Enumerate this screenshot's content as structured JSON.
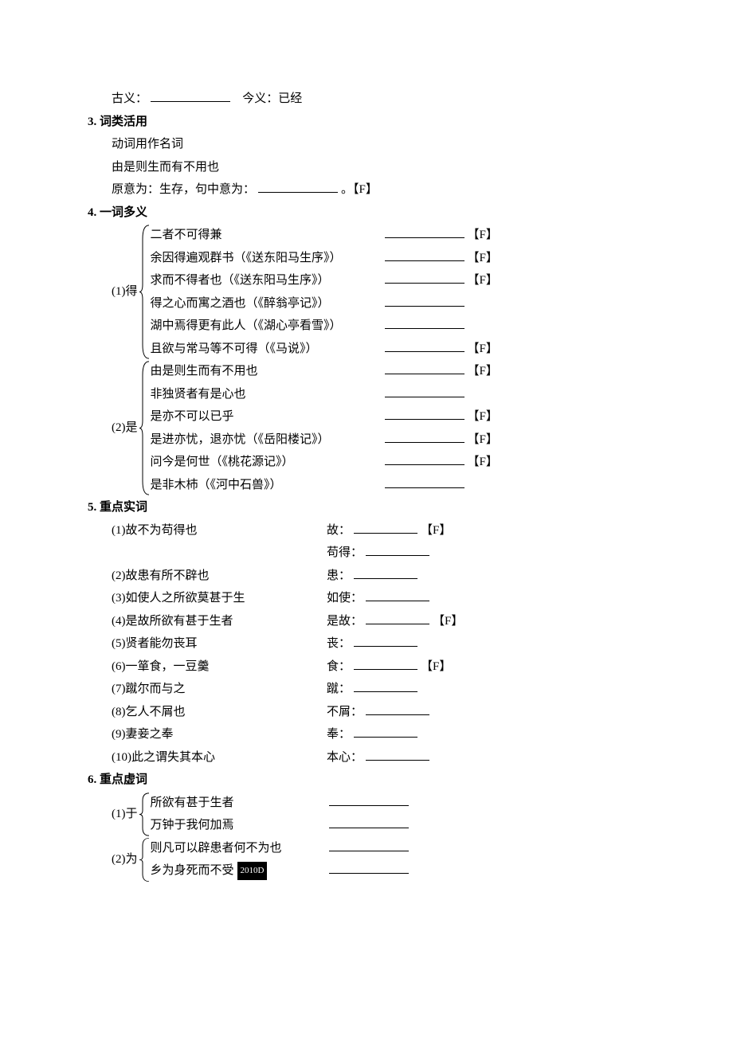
{
  "line_guyi": {
    "prefix": "古义：",
    "today_label": "今义：",
    "today_value": "已经"
  },
  "s3": {
    "heading": "3. 词类活用",
    "l1": "动词用作名词",
    "l2": "由是则生而有不用也",
    "l3a": "原意为：生存，句中意为：",
    "l3b": "。【F】"
  },
  "s4": {
    "heading": "4. 一词多义",
    "g1": {
      "label": "(1)得",
      "items": [
        {
          "text": "二者不可得兼",
          "tag": "【F】"
        },
        {
          "text": "余因得遍观群书（《送东阳马生序》）",
          "tag": "【F】"
        },
        {
          "text": "求而不得者也（《送东阳马生序》）",
          "tag": "【F】"
        },
        {
          "text": "得之心而寓之酒也（《醉翁亭记》）",
          "tag": ""
        },
        {
          "text": "湖中焉得更有此人（《湖心亭看雪》）",
          "tag": ""
        },
        {
          "text": "且欲与常马等不可得（《马说》）",
          "tag": "【F】"
        }
      ]
    },
    "g2": {
      "label": "(2)是",
      "items": [
        {
          "text": "由是则生而有不用也",
          "tag": "【F】"
        },
        {
          "text": "非独贤者有是心也",
          "tag": ""
        },
        {
          "text": "是亦不可以已乎",
          "tag": "【F】"
        },
        {
          "text": "是进亦忧，退亦忧（《岳阳楼记》）",
          "tag": "【F】"
        },
        {
          "text": "问今是何世（《桃花源记》）",
          "tag": "【F】"
        },
        {
          "text": "是非木杮（《河中石兽》）",
          "tag": ""
        }
      ]
    }
  },
  "s5": {
    "heading": "5. 重点实词",
    "items": [
      {
        "num": "(1)",
        "text": "故不为苟得也",
        "labels": [
          {
            "l": "故：",
            "tag": "【F】"
          },
          {
            "l": "苟得：",
            "tag": ""
          }
        ]
      },
      {
        "num": "(2)",
        "text": "故患有所不辟也",
        "labels": [
          {
            "l": "患：",
            "tag": ""
          }
        ]
      },
      {
        "num": "(3)",
        "text": "如使人之所欲莫甚于生",
        "labels": [
          {
            "l": "如使：",
            "tag": ""
          }
        ]
      },
      {
        "num": "(4)",
        "text": "是故所欲有甚于生者",
        "labels": [
          {
            "l": "是故：",
            "tag": "【F】"
          }
        ]
      },
      {
        "num": "(5)",
        "text": "贤者能勿丧耳",
        "labels": [
          {
            "l": "丧：",
            "tag": ""
          }
        ]
      },
      {
        "num": "(6)",
        "text": "一箪食，一豆羹",
        "labels": [
          {
            "l": "食：",
            "tag": "【F】"
          }
        ]
      },
      {
        "num": "(7)",
        "text": "蹴尔而与之",
        "labels": [
          {
            "l": "蹴：",
            "tag": ""
          }
        ]
      },
      {
        "num": "(8)",
        "text": "乞人不屑也",
        "labels": [
          {
            "l": "不屑：",
            "tag": ""
          }
        ]
      },
      {
        "num": "(9)",
        "text": "妻妾之奉",
        "labels": [
          {
            "l": "奉：",
            "tag": ""
          }
        ]
      },
      {
        "num": "(10)",
        "text": "此之谓失其本心",
        "labels": [
          {
            "l": "本心：",
            "tag": ""
          }
        ]
      }
    ]
  },
  "s6": {
    "heading": "6. 重点虚词",
    "g1": {
      "label": "(1)于",
      "items": [
        {
          "text": "所欲有甚于生者"
        },
        {
          "text": "万钟于我何加焉"
        }
      ]
    },
    "g2": {
      "label": "(2)为",
      "items": [
        {
          "text": "则凡可以辟患者何不为也"
        },
        {
          "text": "乡为身死而不受",
          "badge": "2010D"
        }
      ]
    }
  }
}
